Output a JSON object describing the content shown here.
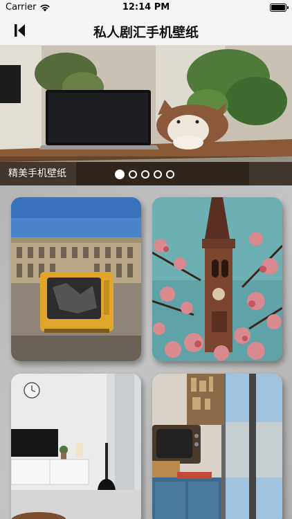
{
  "status_bar": {
    "carrier": "Carrier",
    "time": "12:14 PM"
  },
  "nav": {
    "title": "私人剧汇手机壁纸"
  },
  "banner": {
    "caption": "精美手机壁纸",
    "page_count": 5,
    "active_index": 0
  },
  "wallpapers": [
    {
      "subject": "yellow crt tv in front of colosseum building"
    },
    {
      "subject": "church tower with pink blossoms"
    },
    {
      "subject": "white living room with guitar"
    },
    {
      "subject": "vintage tv on blue cabinet by window"
    }
  ]
}
